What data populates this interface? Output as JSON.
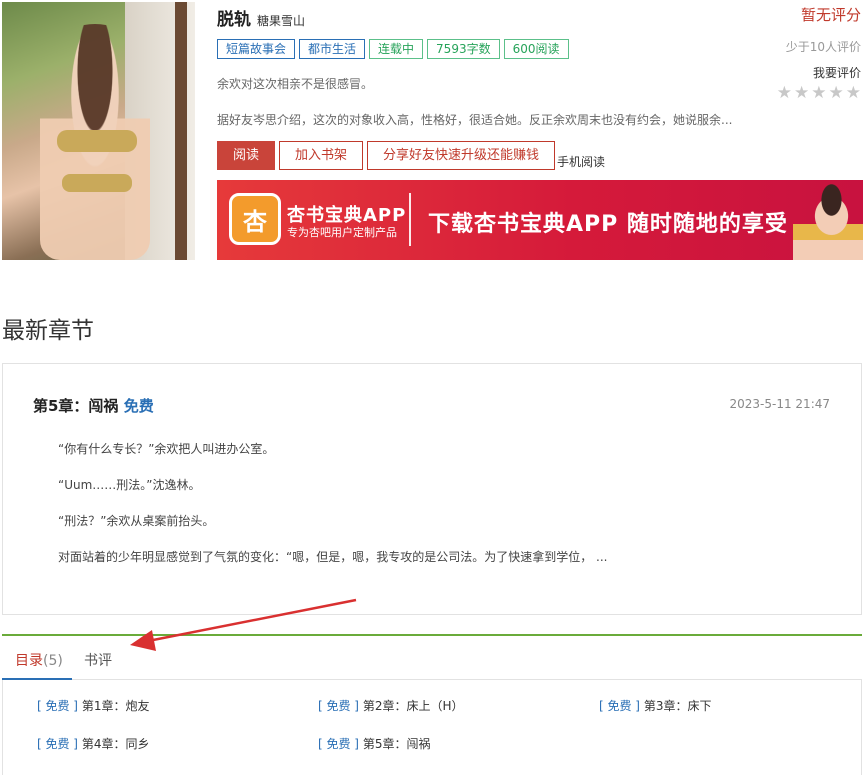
{
  "book": {
    "title": "脱轨",
    "author": "糖果雪山",
    "tags": [
      {
        "label": "短篇故事会",
        "style": "blue"
      },
      {
        "label": "都市生活",
        "style": "blue"
      },
      {
        "label": "连载中",
        "style": "green"
      },
      {
        "label": "7593字数",
        "style": "green"
      },
      {
        "label": "600阅读",
        "style": "green"
      }
    ],
    "tagline": "余欢对这次相亲不是很感冒。",
    "intro": "据好友岑思介绍，这次的对象收入高，性格好，很适合她。反正余欢周末也没有约会，她说服余..."
  },
  "rating": {
    "status": "暂无评分",
    "count_note": "少于10人评价",
    "rate_link": "我要评价",
    "stars_filled": 0,
    "stars_total": 5
  },
  "actions": {
    "read": "阅读",
    "add_shelf": "加入书架",
    "share": "分享好友快速升级还能赚钱",
    "mobile": "手机阅读"
  },
  "banner": {
    "app_name": "杏书宝典APP",
    "app_sub": "专为杏吧用户定制产品",
    "logo_glyph": "杏",
    "slogan": "下载杏书宝典APP 随时随地的享受"
  },
  "latest": {
    "section_title": "最新章节",
    "chapter_title": "第5章：闯祸",
    "free_label": "免费",
    "date": "2023-5-11 21:47",
    "paragraphs": [
      "“你有什么专长？”余欢把人叫进办公室。",
      "“Uum……刑法。”沈逸林。",
      "“刑法？”余欢从桌案前抬头。",
      "对面站着的少年明显感觉到了气氛的变化：“嗯，但是，嗯，我专攻的是公司法。为了快速拿到学位，  ..."
    ]
  },
  "tabs": {
    "catalog": "目录",
    "catalog_count": "(5)",
    "reviews": "书评"
  },
  "chapters": [
    {
      "free": "[ 免费 ]",
      "title": "第1章：炮友"
    },
    {
      "free": "[ 免费 ]",
      "title": "第2章：床上（H）"
    },
    {
      "free": "[ 免费 ]",
      "title": "第3章：床下"
    },
    {
      "free": "[ 免费 ]",
      "title": "第4章：同乡"
    },
    {
      "free": "[ 免费 ]",
      "title": "第5章：闯祸"
    }
  ],
  "colors": {
    "accent_red": "#c0392b",
    "link_blue": "#2a6fb5",
    "tag_green": "#27a35a",
    "tab_border_green": "#6aab3a",
    "annotation_arrow": "#d93030"
  }
}
